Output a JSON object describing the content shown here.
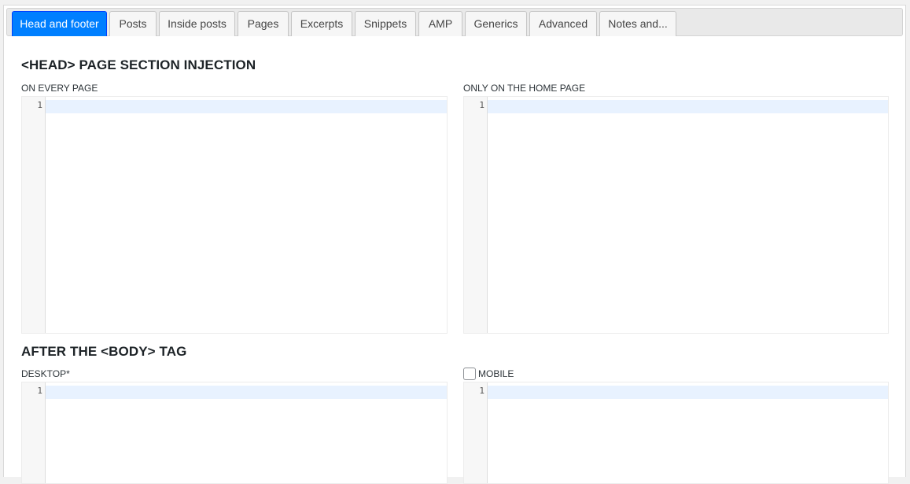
{
  "tabs": [
    {
      "label": "Head and footer",
      "active": true
    },
    {
      "label": "Posts"
    },
    {
      "label": "Inside posts"
    },
    {
      "label": "Pages"
    },
    {
      "label": "Excerpts"
    },
    {
      "label": "Snippets"
    },
    {
      "label": "AMP"
    },
    {
      "label": "Generics"
    },
    {
      "label": "Advanced"
    },
    {
      "label": "Notes and..."
    }
  ],
  "head_section": {
    "title": "<HEAD> PAGE SECTION INJECTION",
    "every_page": {
      "label": "ON EVERY PAGE",
      "line_number": "1",
      "value": ""
    },
    "home_page": {
      "label": "ONLY ON THE HOME PAGE",
      "line_number": "1",
      "value": ""
    }
  },
  "body_section": {
    "title": "AFTER THE <BODY> TAG",
    "desktop": {
      "label": "DESKTOP*",
      "line_number": "1",
      "value": ""
    },
    "mobile": {
      "label": "MOBILE",
      "checked": false,
      "line_number": "1",
      "value": ""
    }
  },
  "colors": {
    "active_tab": "#007fff",
    "active_line": "#e8f2ff"
  }
}
